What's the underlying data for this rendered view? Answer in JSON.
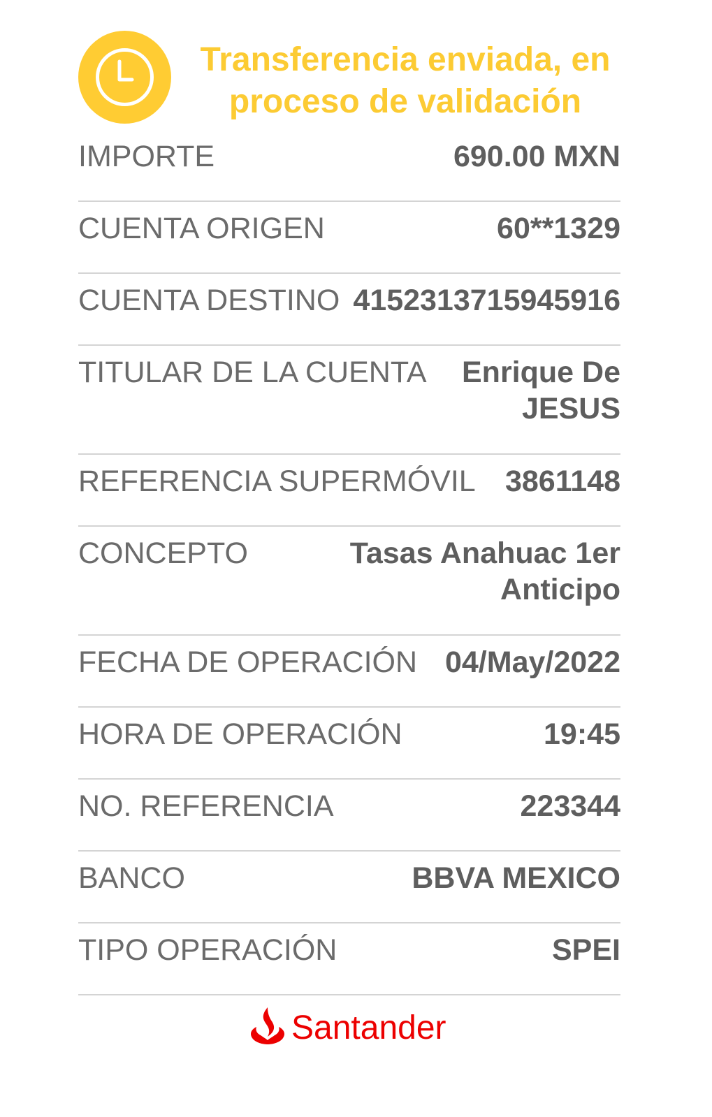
{
  "header": {
    "title": "Transferencia enviada, en proceso de validación",
    "status_icon": "clock-icon",
    "accent_color": "#FCCB33"
  },
  "details": [
    {
      "label": "IMPORTE",
      "value": "690.00 MXN"
    },
    {
      "label": "CUENTA ORIGEN",
      "value": "60**1329"
    },
    {
      "label": "CUENTA DESTINO",
      "value": "4152313715945916"
    },
    {
      "label": "TITULAR DE LA CUENTA",
      "value": "Enrique De JESUS"
    },
    {
      "label": "REFERENCIA SUPERMÓVIL",
      "value": "3861148"
    },
    {
      "label": "CONCEPTO",
      "value": "Tasas Anahuac 1er Anticipo"
    },
    {
      "label": "FECHA DE OPERACIÓN",
      "value": "04/May/2022"
    },
    {
      "label": "HORA DE OPERACIÓN",
      "value": "19:45"
    },
    {
      "label": "NO. REFERENCIA",
      "value": "223344"
    },
    {
      "label": "BANCO",
      "value": "BBVA MEXICO"
    },
    {
      "label": "TIPO OPERACIÓN",
      "value": "SPEI"
    }
  ],
  "brand": {
    "name": "Santander",
    "logo_icon": "santander-flame-icon",
    "color": "#EC0000"
  }
}
